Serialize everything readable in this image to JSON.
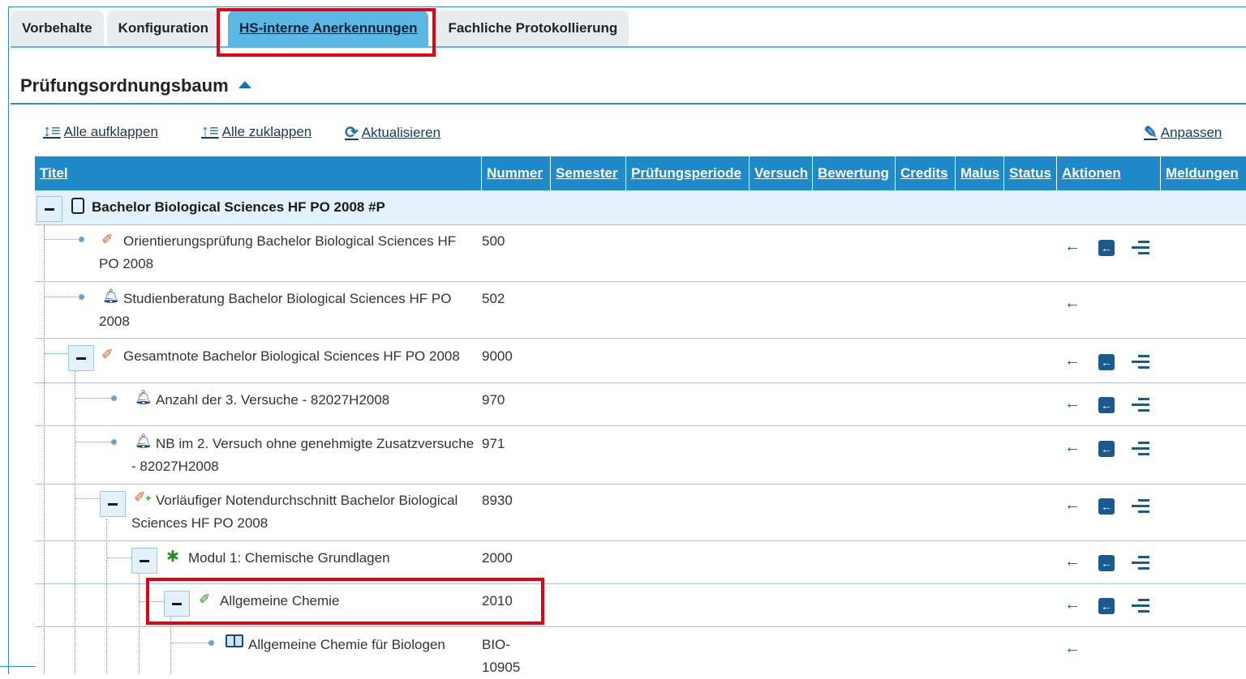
{
  "tabs": [
    {
      "label": "Vorbehalte"
    },
    {
      "label": "Konfiguration"
    },
    {
      "label": "HS-interne Anerkennungen"
    },
    {
      "label": "Fachliche Protokollierung"
    }
  ],
  "section": {
    "title": "Prüfungsordnungsbaum"
  },
  "toolbar": {
    "expand_all": "Alle aufklappen",
    "collapse_all": "Alle zuklappen",
    "refresh": "Aktualisieren",
    "customize": "Anpassen"
  },
  "columns": [
    "Titel",
    "Nummer",
    "Semester",
    "Prüfungsperiode",
    "Versuch",
    "Bewertung",
    "Credits",
    "Malus",
    "Status",
    "Aktionen",
    "Meldungen"
  ],
  "rows": [
    {
      "title": "Bachelor Biological Sciences HF PO 2008 #P",
      "number": ""
    },
    {
      "title": "Orientierungsprüfung Bachelor Biological Sciences HF",
      "title2": "PO 2008",
      "number": "500"
    },
    {
      "title": "Studienberatung Bachelor Biological Sciences HF PO",
      "title2": "2008",
      "number": "502"
    },
    {
      "title": "Gesamtnote Bachelor Biological Sciences HF PO 2008",
      "number": "9000"
    },
    {
      "title": "Anzahl der 3. Versuche - 82027H2008",
      "number": "970"
    },
    {
      "title": "NB im 2. Versuch ohne genehmigte Zusatzversuche",
      "title2": "- 82027H2008",
      "number": "971"
    },
    {
      "title": "Vorläufiger Notendurchschnitt Bachelor Biological",
      "title2": "Sciences HF PO 2008",
      "number": "8930"
    },
    {
      "title": "Modul 1: Chemische Grundlagen",
      "number": "2000"
    },
    {
      "title": "Allgemeine Chemie",
      "number": "2010"
    },
    {
      "title": "Allgemeine Chemie für Biologen",
      "number": "BIO-",
      "number2": "10905"
    }
  ],
  "colors": {
    "accent": "#1f8ac8",
    "highlight": "#e60012",
    "tab_active": "#5bb8e4"
  }
}
